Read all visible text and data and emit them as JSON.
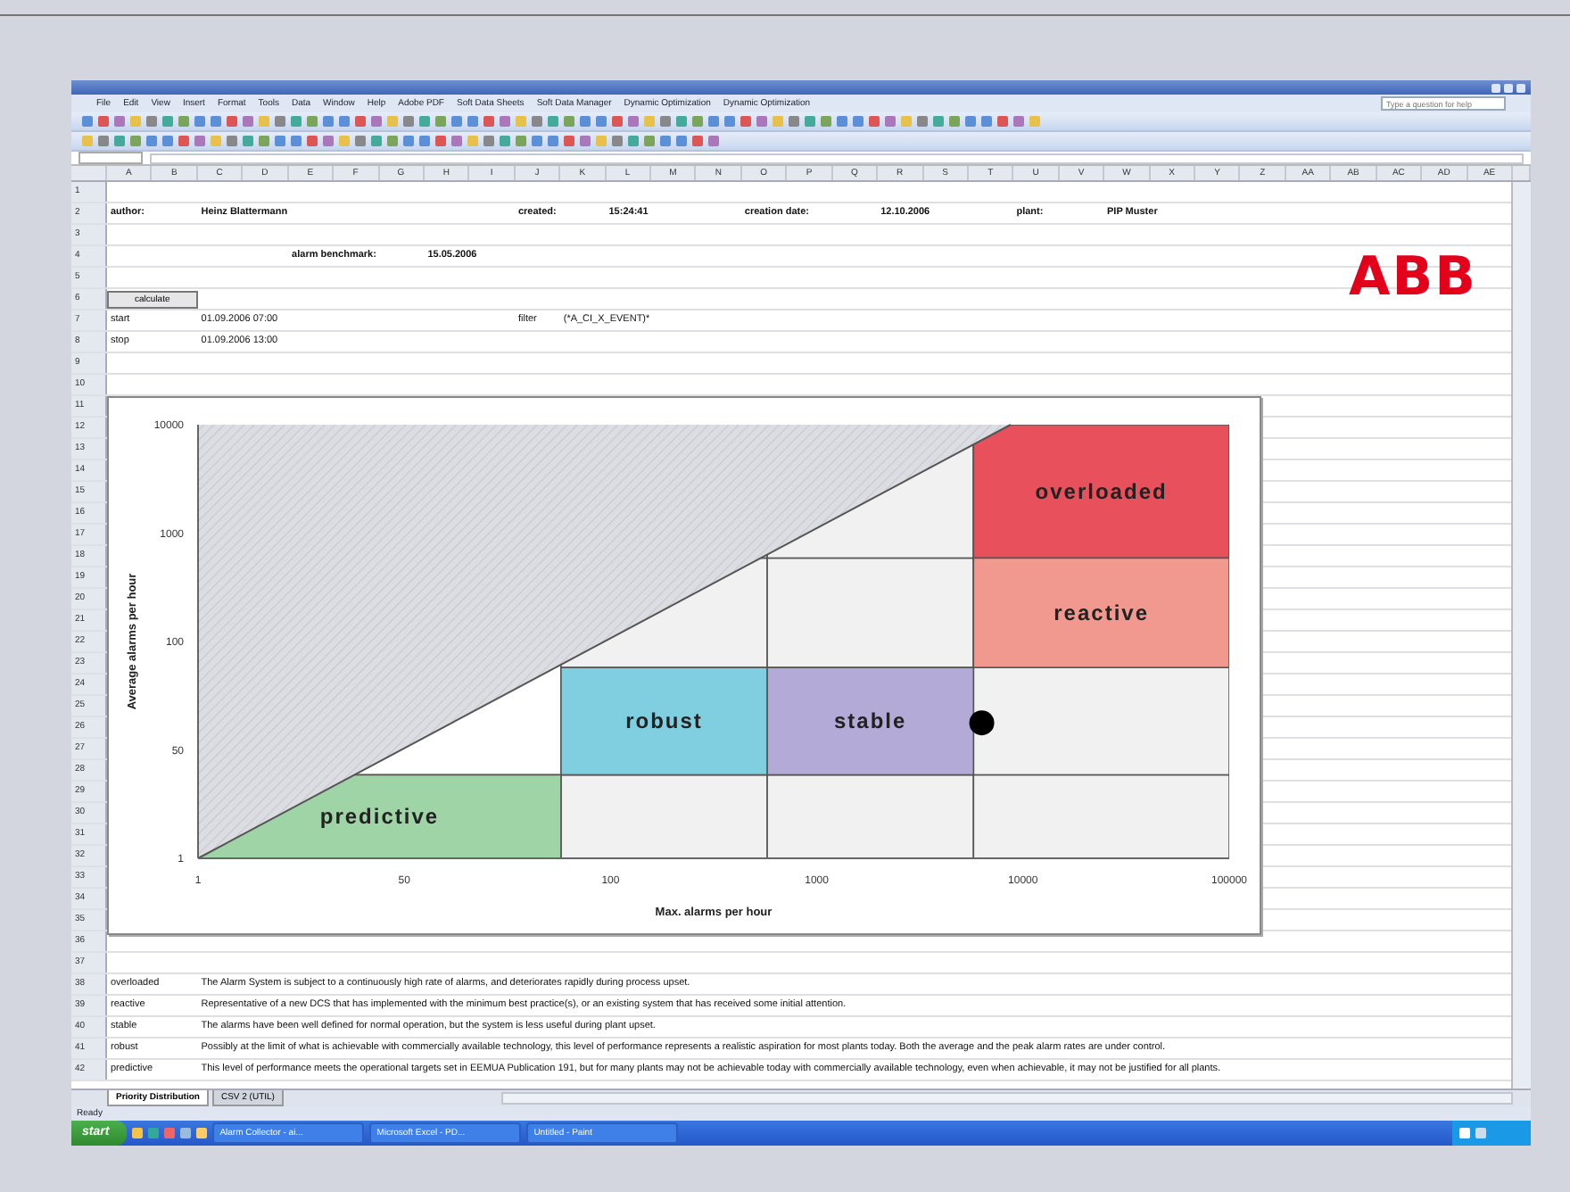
{
  "menu": [
    "File",
    "Edit",
    "View",
    "Insert",
    "Format",
    "Tools",
    "Data",
    "Window",
    "Help",
    "Adobe PDF",
    "Soft Data Sheets",
    "Soft Data Manager",
    "Dynamic Optimization",
    "Dynamic Optimization"
  ],
  "help_box": {
    "placeholder": "Type a question for help"
  },
  "columns": [
    "A",
    "B",
    "C",
    "D",
    "E",
    "F",
    "G",
    "H",
    "I",
    "J",
    "K",
    "L",
    "M",
    "N",
    "O",
    "P",
    "Q",
    "R",
    "S",
    "T",
    "U",
    "V",
    "W",
    "X",
    "Y",
    "Z",
    "AA",
    "AB",
    "AC",
    "AD",
    "AE"
  ],
  "row_numbers": [
    "1",
    "2",
    "3",
    "4",
    "5",
    "6",
    "7",
    "8",
    "9",
    "10",
    "11",
    "12",
    "13",
    "14",
    "15",
    "16",
    "17",
    "18",
    "19",
    "20",
    "21",
    "22",
    "23",
    "24",
    "25",
    "26",
    "27",
    "28",
    "29",
    "30",
    "31",
    "32",
    "33",
    "34",
    "35",
    "36",
    "37",
    "38",
    "39",
    "40",
    "41",
    "42"
  ],
  "info": {
    "author_label": "author:",
    "author": "Heinz Blattermann",
    "created_label": "created:",
    "created": "15:24:41",
    "date_label": "creation date:",
    "date": "12.10.2006",
    "plant_label": "plant:",
    "plant": "PIP Muster",
    "benchmark_label": "alarm benchmark:",
    "benchmark": "15.05.2006"
  },
  "calculate_button": "calculate",
  "start": {
    "label": "start",
    "value": "01.09.2006 07:00"
  },
  "stop": {
    "label": "stop",
    "value": "01.09.2006 13:00"
  },
  "filter": {
    "label": "filter",
    "value": "(*A_CI_X_EVENT)*"
  },
  "logo": "ABB",
  "chart": {
    "x_axis_title": "Max. alarms per hour",
    "y_axis_title": "Average alarms per hour",
    "x_tick_labels": [
      "1",
      "50",
      "100",
      "1000",
      "10000",
      "100000"
    ],
    "y_tick_labels": [
      "10000",
      "1000",
      "100",
      "50",
      "1"
    ],
    "zones": [
      {
        "label": "overloaded",
        "color": "#e8505b"
      },
      {
        "label": "reactive",
        "color": "#f2998f"
      },
      {
        "label": "robust",
        "color": "#7fcfe0"
      },
      {
        "label": "stable",
        "color": "#b3aad8"
      },
      {
        "label": "predictive",
        "color": "#9fd4a6"
      }
    ]
  },
  "descriptions": [
    {
      "term": "overloaded",
      "text": "The Alarm System is subject to a continuously high rate of alarms, and deteriorates rapidly during process upset."
    },
    {
      "term": "reactive",
      "text": "Representative of a new DCS that has implemented with the minimum best practice(s), or an existing system that has received some initial attention."
    },
    {
      "term": "stable",
      "text": "The alarms have been well defined for normal operation, but the system is less useful during plant upset."
    },
    {
      "term": "robust",
      "text": "Possibly at the limit of what is achievable with commercially available technology, this level of performance represents a realistic aspiration for most plants today.  Both the average and the peak alarm rates are under control."
    },
    {
      "term": "predictive",
      "text": "This level of performance meets the operational targets set in EEMUA Publication 191, but for many plants may not be achievable today with commercially available technology, even when achievable, it may not be justified for all plants."
    }
  ],
  "sheet_tabs": [
    {
      "label": "Priority Distribution",
      "selected": true
    },
    {
      "label": "CSV 2 (UTIL)",
      "selected": false
    }
  ],
  "status": "Ready",
  "taskbar": {
    "start": "start",
    "tasks": [
      "Alarm Collector - ai...",
      "Microsoft Excel - PD...",
      "Untitled - Paint"
    ]
  }
}
